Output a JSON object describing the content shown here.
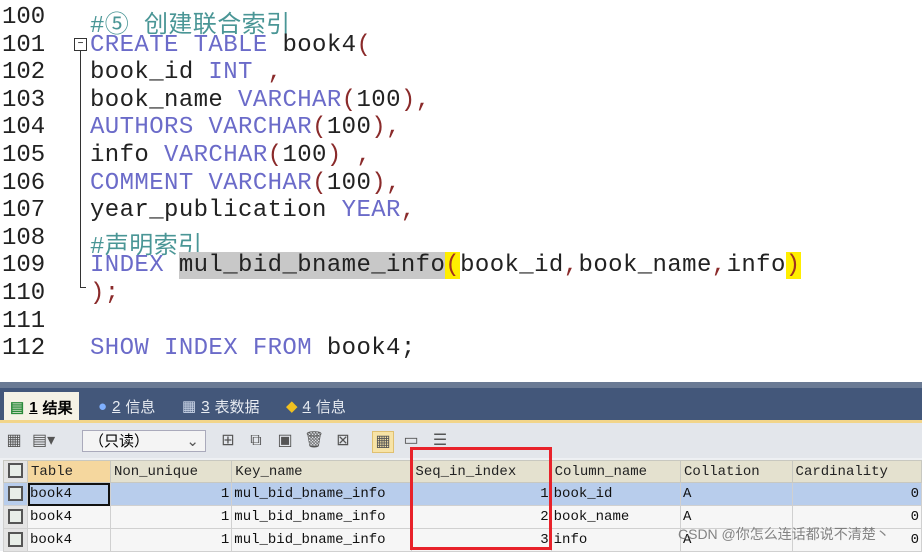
{
  "editor": {
    "lines": [
      {
        "no": "100",
        "tokens": [
          {
            "t": "#⑤ 创建联合索引",
            "c": "cm"
          }
        ]
      },
      {
        "no": "101",
        "tokens": [
          {
            "t": "CREATE TABLE",
            "c": "kw"
          },
          {
            "t": " book4",
            "c": ""
          },
          {
            "t": "(",
            "c": "pn"
          }
        ]
      },
      {
        "no": "102",
        "tokens": [
          {
            "t": "book_id ",
            "c": ""
          },
          {
            "t": "INT",
            "c": "kw"
          },
          {
            "t": " ,",
            "c": "pn"
          }
        ]
      },
      {
        "no": "103",
        "tokens": [
          {
            "t": "book_name ",
            "c": ""
          },
          {
            "t": "VARCHAR",
            "c": "kw"
          },
          {
            "t": "(",
            "c": "pn"
          },
          {
            "t": "100",
            "c": ""
          },
          {
            "t": "),",
            "c": "pn"
          }
        ]
      },
      {
        "no": "104",
        "tokens": [
          {
            "t": "AUTHORS",
            "c": "kw"
          },
          {
            "t": " ",
            "c": ""
          },
          {
            "t": "VARCHAR",
            "c": "kw"
          },
          {
            "t": "(",
            "c": "pn"
          },
          {
            "t": "100",
            "c": ""
          },
          {
            "t": "),",
            "c": "pn"
          }
        ]
      },
      {
        "no": "105",
        "tokens": [
          {
            "t": "info ",
            "c": ""
          },
          {
            "t": "VARCHAR",
            "c": "kw"
          },
          {
            "t": "(",
            "c": "pn"
          },
          {
            "t": "100",
            "c": ""
          },
          {
            "t": ") ,",
            "c": "pn"
          }
        ]
      },
      {
        "no": "106",
        "tokens": [
          {
            "t": "COMMENT",
            "c": "kw"
          },
          {
            "t": " ",
            "c": ""
          },
          {
            "t": "VARCHAR",
            "c": "kw"
          },
          {
            "t": "(",
            "c": "pn"
          },
          {
            "t": "100",
            "c": ""
          },
          {
            "t": "),",
            "c": "pn"
          }
        ]
      },
      {
        "no": "107",
        "tokens": [
          {
            "t": "year_publication ",
            "c": ""
          },
          {
            "t": "YEAR",
            "c": "kw"
          },
          {
            "t": ",",
            "c": "pn"
          }
        ]
      },
      {
        "no": "108",
        "tokens": [
          {
            "t": "#声明索引",
            "c": "cm"
          }
        ]
      },
      {
        "no": "109",
        "tokens": [
          {
            "t": "INDEX",
            "c": "kw"
          },
          {
            "t": " ",
            "c": ""
          },
          {
            "t": "mul_bid_bname_info",
            "c": "sel"
          },
          {
            "t": "(",
            "c": "br"
          },
          {
            "t": "book_id",
            "c": ""
          },
          {
            "t": ",",
            "c": "pn"
          },
          {
            "t": "book_name",
            "c": ""
          },
          {
            "t": ",",
            "c": "pn"
          },
          {
            "t": "info",
            "c": ""
          },
          {
            "t": ")",
            "c": "br"
          }
        ]
      },
      {
        "no": "110",
        "tokens": [
          {
            "t": ");",
            "c": "pn"
          }
        ]
      },
      {
        "no": "111",
        "tokens": []
      },
      {
        "no": "112",
        "tokens": [
          {
            "t": "SHOW INDEX FROM",
            "c": "kw"
          },
          {
            "t": " book4;",
            "c": ""
          }
        ]
      }
    ]
  },
  "tabs": [
    {
      "num": "1",
      "label": "结果",
      "icon": "result-grid-icon"
    },
    {
      "num": "2",
      "label": "信息",
      "icon": "info-icon"
    },
    {
      "num": "3",
      "label": "表数据",
      "icon": "table-data-icon"
    },
    {
      "num": "4",
      "label": "信息",
      "icon": "info-shapes-icon"
    }
  ],
  "toolbar": {
    "mode": "（只读）"
  },
  "grid": {
    "columns": [
      "Table",
      "Non_unique",
      "Key_name",
      "Seq_in_index",
      "Column_name",
      "Collation",
      "Cardinality"
    ],
    "rows": [
      [
        "book4",
        "1",
        "mul_bid_bname_info",
        "1",
        "book_id",
        "A",
        "0"
      ],
      [
        "book4",
        "1",
        "mul_bid_bname_info",
        "2",
        "book_name",
        "A",
        "0"
      ],
      [
        "book4",
        "1",
        "mul_bid_bname_info",
        "3",
        "info",
        "A",
        "0"
      ]
    ]
  },
  "watermark": "CSDN @你怎么连话都说不清楚丶",
  "colors": {
    "highlight_box": "#e8222a",
    "keyword": "#6b6bc9",
    "comment": "#4a9696",
    "selected_row": "#b8cdec"
  }
}
